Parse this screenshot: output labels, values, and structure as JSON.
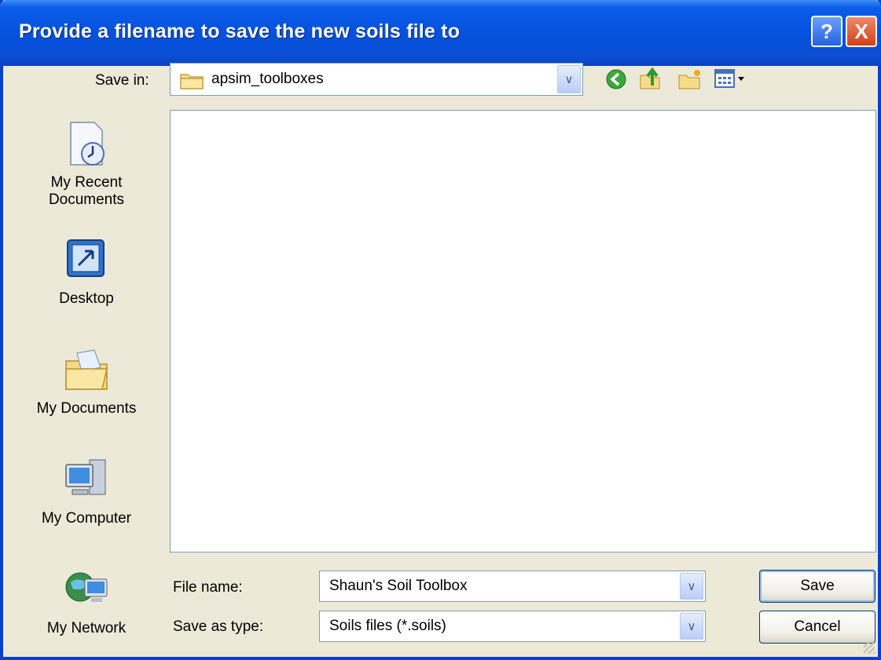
{
  "dialog": {
    "title": "Provide a filename to save the new soils file to",
    "help_glyph": "?",
    "close_glyph": "X"
  },
  "save_in": {
    "label": "Save in:",
    "value": "apsim_toolboxes",
    "icon": "folder-icon"
  },
  "toolbar": {
    "back_icon": "back-arrow-icon",
    "up_icon": "up-folder-icon",
    "new_folder_icon": "new-folder-icon",
    "views_icon": "views-menu-icon"
  },
  "places": [
    {
      "label_line1": "My Recent",
      "label_line2": "Documents",
      "icon": "recent-documents-icon"
    },
    {
      "label_line1": "Desktop",
      "label_line2": "",
      "icon": "desktop-icon"
    },
    {
      "label_line1": "My Documents",
      "label_line2": "",
      "icon": "my-documents-icon"
    },
    {
      "label_line1": "My Computer",
      "label_line2": "",
      "icon": "my-computer-icon"
    },
    {
      "label_line1": "My Network",
      "label_line2": "",
      "icon": "my-network-icon"
    }
  ],
  "file_name": {
    "label": "File name:",
    "value": "Shaun's Soil Toolbox"
  },
  "save_as_type": {
    "label": "Save as type:",
    "value": "Soils files (*.soils)"
  },
  "buttons": {
    "save": "Save",
    "cancel": "Cancel"
  }
}
